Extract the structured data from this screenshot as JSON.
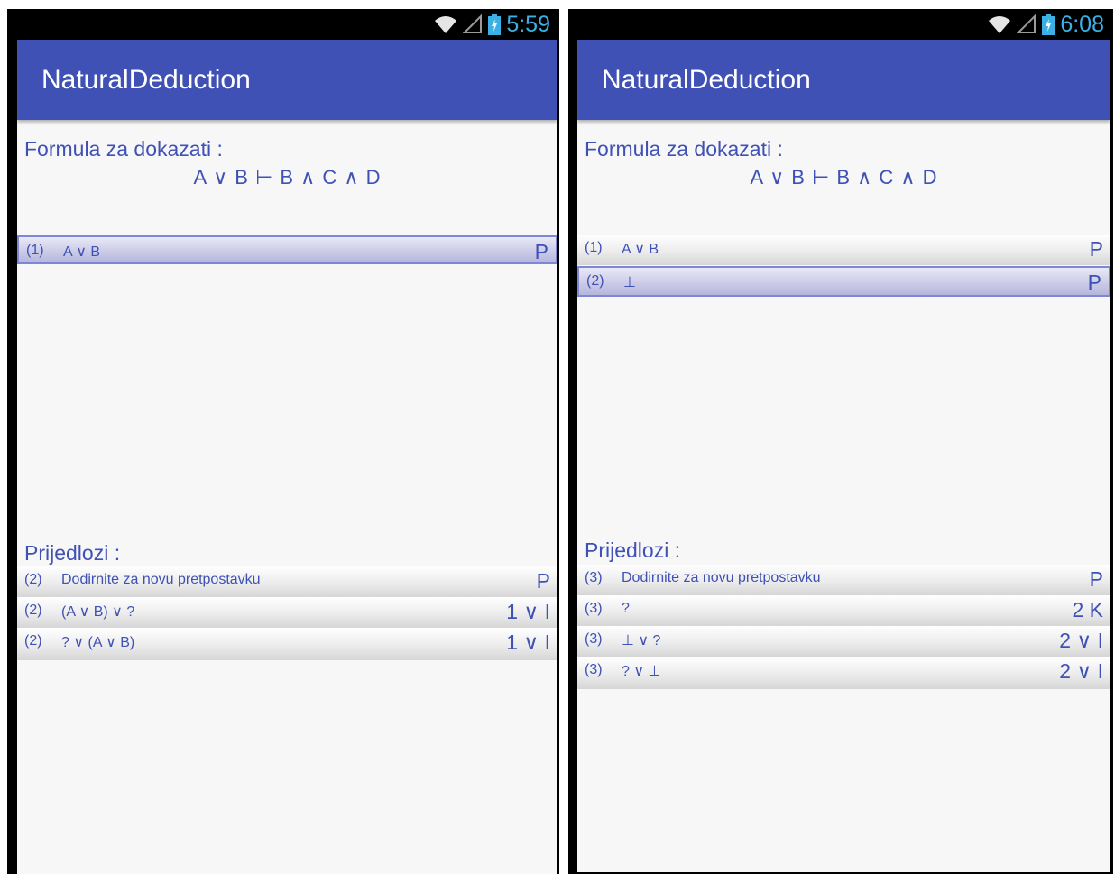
{
  "left": {
    "status_time": "5:59",
    "app_title": "NaturalDeduction",
    "formula_label": "Formula za dokazati :",
    "formula": "A ∨ B ⊢ B ∧ C ∧ D",
    "proof_lines": [
      {
        "num": "(1)",
        "text": "A ∨ B",
        "rule": "P",
        "selected": true
      }
    ],
    "suggestions_label": "Prijedlozi :",
    "suggestions": [
      {
        "num": "(2)",
        "text": "Dodirnite za novu pretpostavku",
        "rule": "P"
      },
      {
        "num": "(2)",
        "text": "(A ∨ B) ∨ ?",
        "rule": "1 ∨ I"
      },
      {
        "num": "(2)",
        "text": "? ∨ (A ∨ B)",
        "rule": "1 ∨ I"
      }
    ]
  },
  "right": {
    "status_time": "6:08",
    "app_title": "NaturalDeduction",
    "formula_label": "Formula za dokazati :",
    "formula": "A ∨ B ⊢ B ∧ C ∧ D",
    "proof_lines": [
      {
        "num": "(1)",
        "text": "A ∨ B",
        "rule": "P",
        "selected": false
      },
      {
        "num": "(2)",
        "text": "⊥",
        "rule": "P",
        "selected": true
      }
    ],
    "suggestions_label": "Prijedlozi :",
    "suggestions": [
      {
        "num": "(3)",
        "text": "Dodirnite za novu pretpostavku",
        "rule": "P"
      },
      {
        "num": "(3)",
        "text": "?",
        "rule": "2 K"
      },
      {
        "num": "(3)",
        "text": "⊥ ∨ ?",
        "rule": "2 ∨ I"
      },
      {
        "num": "(3)",
        "text": "? ∨ ⊥",
        "rule": "2 ∨ I"
      }
    ]
  },
  "icons": [
    "wifi-icon",
    "signal-icon",
    "battery-icon"
  ],
  "colors": {
    "primary": "#3f51b5",
    "status_time": "#3ab0e4",
    "status_bar": "#000000",
    "screen_background": "#f7f7f7"
  }
}
